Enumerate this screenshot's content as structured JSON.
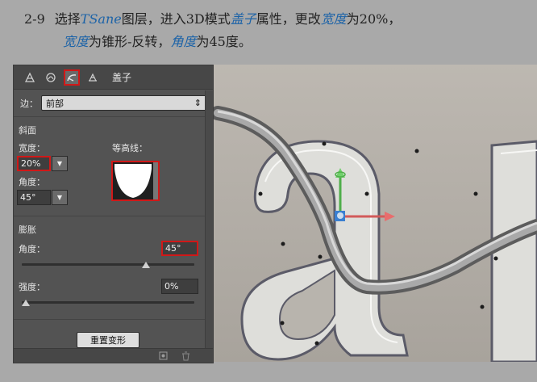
{
  "caption": {
    "step": "2-9",
    "parts1": [
      "选择",
      "TSane",
      "图层，进入3D模式",
      "盖子",
      "属性，更改",
      "宽度",
      "为20%，"
    ],
    "parts2": [
      "宽度",
      "为锥形-反转，",
      "角度",
      "为45度。"
    ]
  },
  "panel": {
    "title": "盖子",
    "side_label": "边：",
    "side_value": "前部",
    "bevel": {
      "title": "斜面",
      "width_label": "宽度：",
      "width_value": "20%",
      "contour_label": "等高线：",
      "angle_label": "角度：",
      "angle_value": "45°"
    },
    "inflate": {
      "title": "膨胀",
      "angle_label": "角度：",
      "angle_value": "45°",
      "angle_slider": 0.72,
      "strength_label": "强度：",
      "strength_value": "0%",
      "strength_slider": 0.0
    },
    "reset_label": "重置变形"
  },
  "colors": {
    "highlight": "#d01818",
    "keyword": "#1c63a8"
  }
}
